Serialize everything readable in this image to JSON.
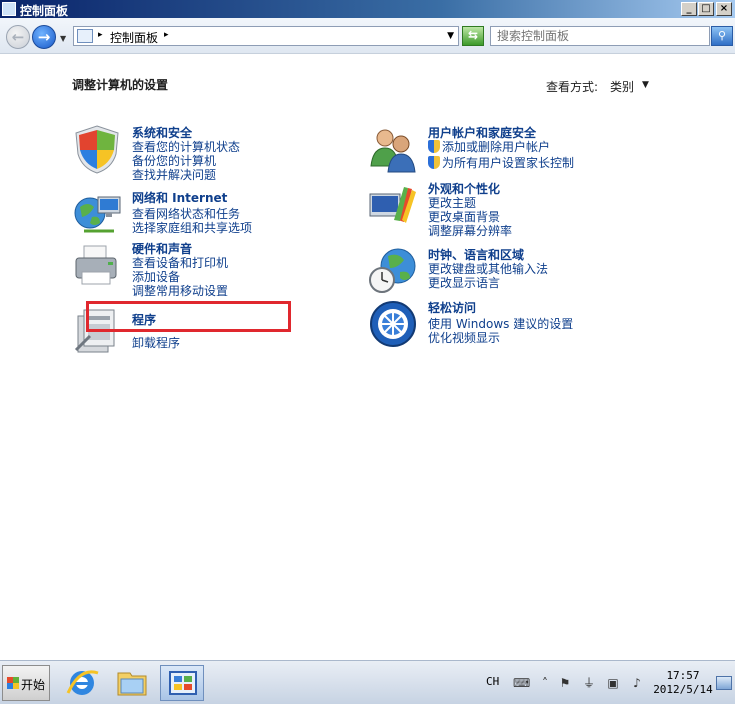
{
  "window": {
    "title": "控制面板"
  },
  "titlebar_buttons": {
    "minimize": "_",
    "maximize": "□",
    "close": "×"
  },
  "address": {
    "crumb": "控制面板",
    "search_placeholder": "搜索控制面板"
  },
  "content": {
    "heading": "调整计算机的设置",
    "view_by_label": "查看方式:",
    "view_by_value": "类别"
  },
  "categories": [
    {
      "title": "系统和安全",
      "links": [
        "查看您的计算机状态",
        "备份您的计算机",
        "查找并解决问题"
      ],
      "icon": "shield-icon"
    },
    {
      "title": "网络和 Internet",
      "links": [
        "查看网络状态和任务",
        "选择家庭组和共享选项"
      ],
      "icon": "network-icon"
    },
    {
      "title": "硬件和声音",
      "links": [
        "查看设备和打印机",
        "添加设备",
        "调整常用移动设置"
      ],
      "icon": "printer-icon"
    },
    {
      "title": "程序",
      "links": [
        "卸载程序"
      ],
      "icon": "programs-icon"
    },
    {
      "title": "用户帐户和家庭安全",
      "links": [
        "添加或删除用户帐户",
        "为所有用户设置家长控制"
      ],
      "icon": "users-icon"
    },
    {
      "title": "外观和个性化",
      "links": [
        "更改主题",
        "更改桌面背景",
        "调整屏幕分辨率"
      ],
      "icon": "appearance-icon"
    },
    {
      "title": "时钟、语言和区域",
      "links": [
        "更改键盘或其他输入法",
        "更改显示语言"
      ],
      "icon": "clock-globe-icon"
    },
    {
      "title": "轻松访问",
      "links": [
        "使用 Windows 建议的设置",
        "优化视频显示"
      ],
      "icon": "ease-of-access-icon"
    }
  ],
  "taskbar": {
    "start_label": "开始",
    "language": "CH",
    "time": "17:57",
    "date": "2012/5/14"
  },
  "colors": {
    "link": "#0f3f8c",
    "highlight": "#e0282e"
  }
}
